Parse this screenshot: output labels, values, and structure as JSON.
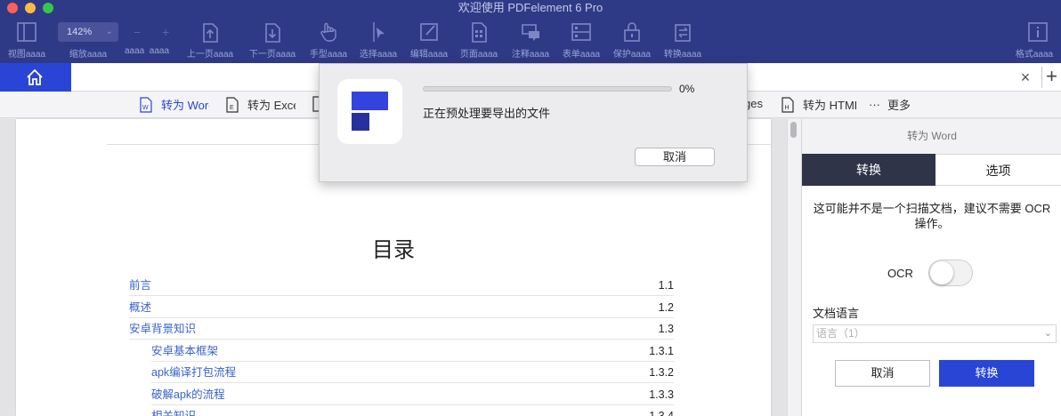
{
  "window": {
    "title": "欢迎使用 PDFelement 6 Pro"
  },
  "toolbar": {
    "zoom": "142%",
    "items": [
      {
        "label": "视图aaaa",
        "icon": "view-icon"
      },
      {
        "label": "缩放aaaa",
        "icon": "zoom-icon"
      },
      {
        "label": "上一页aaaa",
        "icon": "prev-page-icon"
      },
      {
        "label": "下一页aaaa",
        "icon": "next-page-icon"
      },
      {
        "label": "手型aaaa",
        "icon": "hand-icon"
      },
      {
        "label": "选择aaaa",
        "icon": "select-icon"
      },
      {
        "label": "编辑aaaa",
        "icon": "edit-icon"
      },
      {
        "label": "页面aaaa",
        "icon": "page-icon"
      },
      {
        "label": "注释aaaa",
        "icon": "comment-icon"
      },
      {
        "label": "表单aaaa",
        "icon": "form-icon"
      },
      {
        "label": "保护aaaa",
        "icon": "protect-icon"
      },
      {
        "label": "转换aaaa",
        "icon": "convert-icon"
      },
      {
        "label": "格式aaaa",
        "icon": "format-icon"
      }
    ],
    "small_labels": "aaaa  aaaa"
  },
  "convert_bar": {
    "items": [
      {
        "label": "转为 Word",
        "badge": "W"
      },
      {
        "label": "转为 Excel",
        "badge": "E"
      },
      {
        "label": "ges",
        "badge": ""
      },
      {
        "label": "转为 HTML",
        "badge": "H"
      }
    ],
    "more_label": "更多",
    "more_glyph": "···"
  },
  "document": {
    "title": "目录",
    "toc": [
      {
        "title": "前言",
        "num": "1.1"
      },
      {
        "title": "概述",
        "num": "1.2"
      },
      {
        "title": "安卓背景知识",
        "num": "1.3"
      },
      {
        "title": "安卓基本框架",
        "num": "1.3.1"
      },
      {
        "title": "apk编译打包流程",
        "num": "1.3.2"
      },
      {
        "title": "破解apk的流程",
        "num": "1.3.3"
      },
      {
        "title": "相关知识",
        "num": "1.3.4"
      }
    ]
  },
  "right_panel": {
    "header": "转为 Word",
    "tab_convert": "转换",
    "tab_options": "选项",
    "note": "这可能并不是一个扫描文档，建议不需要 OCR 操作。",
    "ocr_label": "OCR",
    "ocr_enabled": false,
    "language_label": "文档语言",
    "language_value": "语言（1）",
    "cancel_label": "取消",
    "convert_label": "转换"
  },
  "modal": {
    "progress_text": "0%",
    "progress": 0,
    "message": "正在预处理要导出的文件",
    "cancel_label": "取消"
  },
  "colors": {
    "accent": "#2945d6",
    "toolbar": "#2f3a86",
    "tab_active": "#2f3449"
  }
}
